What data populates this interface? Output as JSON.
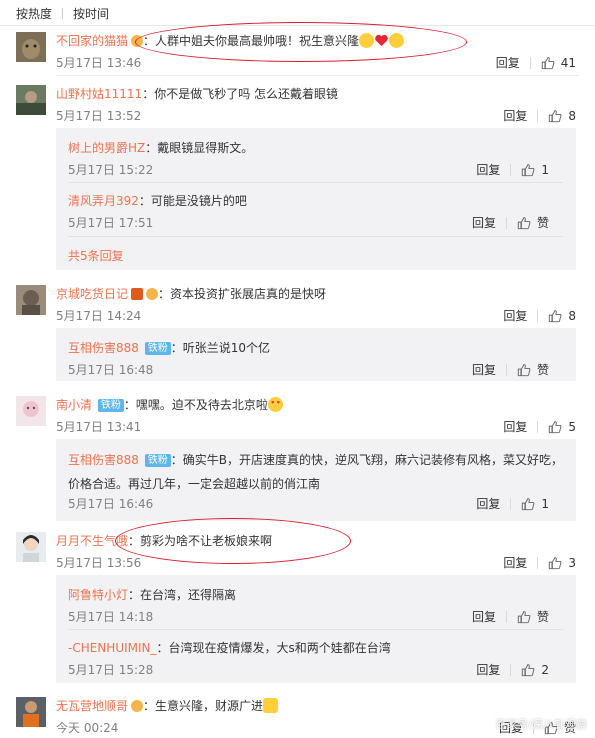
{
  "sort_tabs": {
    "hot": "按热度",
    "time": "按时间"
  },
  "reply_label": "回复",
  "comments": [
    {
      "user": "不回家的猫猫",
      "text": "：人群中姐夫你最高最帅哦！祝生意兴隆",
      "time": "5月17日 13:46",
      "likes": "41",
      "circled": true
    },
    {
      "user": "山野村姑11111",
      "text": "：你不是做飞秒了吗 怎么还戴着眼镜",
      "time": "5月17日 13:52",
      "likes": "8",
      "replies": [
        {
          "user": "树上的男爵HZ",
          "text": "：戴眼镜显得斯文。",
          "time": "5月17日 15:22",
          "likes": "1"
        },
        {
          "user": "清风弄月392",
          "text": "：可能是没镜片的吧",
          "time": "5月17日 17:51",
          "likes": "赞"
        }
      ],
      "more_replies": "共5条回复"
    },
    {
      "user": "京城吃货日记",
      "text": "：资本投资扩张展店真的是快呀",
      "time": "5月17日 14:24",
      "likes": "8",
      "replies": [
        {
          "user": "互相伤害888",
          "badge": "铁粉",
          "text": "：听张兰说10个亿",
          "time": "5月17日 16:48",
          "likes": "赞"
        }
      ]
    },
    {
      "user": "南小清",
      "badge": "铁粉",
      "text": "：嘿嘿。迫不及待去北京啦",
      "time": "5月17日 13:41",
      "likes": "5",
      "replies": [
        {
          "user": "互相伤害888",
          "badge": "铁粉",
          "text": "：确实牛B，开店速度真的快，逆风飞翔，麻六记装修有风格，菜又好吃，",
          "text2": "价格合适。再过几年，一定会超越以前的俏江南",
          "time": "5月17日 16:46",
          "likes": "1"
        }
      ]
    },
    {
      "user": "月月不生气哦",
      "text": "：剪彩为啥不让老板娘来啊",
      "time": "5月17日 13:56",
      "likes": "3",
      "circled": true,
      "replies": [
        {
          "user": "阿鲁特小灯",
          "text": "：在台湾，还得隔离",
          "time": "5月17日 14:18",
          "likes": "赞"
        },
        {
          "user": "-CHENHUIMIN_",
          "text": "：台湾现在疫情爆发，大s和两个娃都在台湾",
          "time": "5月17日 15:28",
          "likes": "2"
        }
      ]
    },
    {
      "user": "无瓦营地顺哥",
      "text": "：生意兴隆，财源广进",
      "time": "今天 00:24",
      "likes": "赞"
    }
  ],
  "watermark": "百家号/深八卦观察"
}
